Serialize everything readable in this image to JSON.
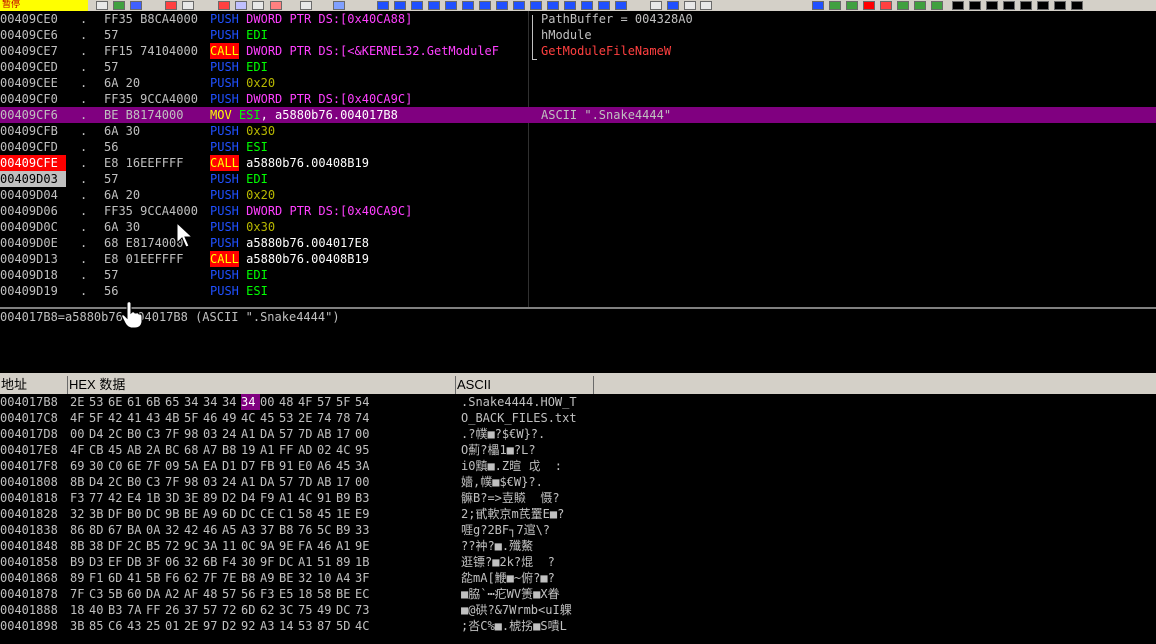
{
  "toolbar": {
    "status": "暂停",
    "colors": {
      "bar": "#d4d0c8",
      "status_bg": "#ffff00",
      "status_text": "#c00000"
    }
  },
  "cpu": {
    "rows": [
      {
        "addr": "00409CE0",
        "mark": ".",
        "hex": "FF35 B8CA4000",
        "op": "PUSH",
        "mcls": "mn-push",
        "parts": [
          {
            "t": "DWORD PTR DS:[0x40CA88]",
            "c": "op-mem"
          }
        ],
        "comment": "PathBuffer = 004328A0",
        "ccls": "",
        "addrcls": "",
        "sel": false
      },
      {
        "addr": "00409CE6",
        "mark": ".",
        "hex": "57",
        "op": "PUSH",
        "mcls": "mn-push",
        "parts": [
          {
            "t": "EDI",
            "c": "op-reg"
          }
        ],
        "comment": "hModule",
        "ccls": "",
        "addrcls": "",
        "sel": false
      },
      {
        "addr": "00409CE7",
        "mark": ".",
        "hex": "FF15 74104000",
        "op": "CALL",
        "mcls": "mn-call",
        "parts": [
          {
            "t": "DWORD PTR DS:[<&KERNEL32.GetModuleF",
            "c": "op-mem"
          }
        ],
        "comment": "GetModuleFileNameW",
        "ccls": "api",
        "addrcls": "",
        "sel": false
      },
      {
        "addr": "00409CED",
        "mark": ".",
        "hex": "57",
        "op": "PUSH",
        "mcls": "mn-push",
        "parts": [
          {
            "t": "EDI",
            "c": "op-reg"
          }
        ],
        "comment": "",
        "ccls": "",
        "addrcls": "",
        "sel": false
      },
      {
        "addr": "00409CEE",
        "mark": ".",
        "hex": "6A 20",
        "op": "PUSH",
        "mcls": "mn-push",
        "parts": [
          {
            "t": "0x20",
            "c": "op-imm"
          }
        ],
        "comment": "",
        "ccls": "",
        "addrcls": "",
        "sel": false
      },
      {
        "addr": "00409CF0",
        "mark": ".",
        "hex": "FF35 9CCA4000",
        "op": "PUSH",
        "mcls": "mn-push",
        "parts": [
          {
            "t": "DWORD PTR DS:[0x40CA9C]",
            "c": "op-mem"
          }
        ],
        "comment": "",
        "ccls": "",
        "addrcls": "",
        "sel": false
      },
      {
        "addr": "00409CF6",
        "mark": ".",
        "hex": "BE B8174000",
        "op": "MOV",
        "mcls": "mn-mov",
        "parts": [
          {
            "t": "ESI",
            "c": "op-reg"
          },
          {
            "t": ", a5880b76.004017B8",
            "c": "op-addr"
          }
        ],
        "comment": "ASCII \".Snake4444\"",
        "ccls": "",
        "addrcls": "",
        "sel": true
      },
      {
        "addr": "00409CFB",
        "mark": ".",
        "hex": "6A 30",
        "op": "PUSH",
        "mcls": "mn-push",
        "parts": [
          {
            "t": "0x30",
            "c": "op-imm"
          }
        ],
        "comment": "",
        "ccls": "",
        "addrcls": "",
        "sel": false
      },
      {
        "addr": "00409CFD",
        "mark": ".",
        "hex": "56",
        "op": "PUSH",
        "mcls": "mn-push",
        "parts": [
          {
            "t": "ESI",
            "c": "op-reg"
          }
        ],
        "comment": "",
        "ccls": "",
        "addrcls": "",
        "sel": false
      },
      {
        "addr": "00409CFE",
        "mark": ".",
        "hex": "E8 16EEFFFF",
        "op": "CALL",
        "mcls": "mn-call",
        "parts": [
          {
            "t": "a5880b76.00408B19",
            "c": "op-addr"
          }
        ],
        "comment": "",
        "ccls": "",
        "addrcls": "bp",
        "sel": false
      },
      {
        "addr": "00409D03",
        "mark": ".",
        "hex": "57",
        "op": "PUSH",
        "mcls": "mn-push",
        "parts": [
          {
            "t": "EDI",
            "c": "op-reg"
          }
        ],
        "comment": "",
        "ccls": "",
        "addrcls": "eip",
        "sel": false
      },
      {
        "addr": "00409D04",
        "mark": ".",
        "hex": "6A 20",
        "op": "PUSH",
        "mcls": "mn-push",
        "parts": [
          {
            "t": "0x20",
            "c": "op-imm"
          }
        ],
        "comment": "",
        "ccls": "",
        "addrcls": "",
        "sel": false
      },
      {
        "addr": "00409D06",
        "mark": ".",
        "hex": "FF35 9CCA4000",
        "op": "PUSH",
        "mcls": "mn-push",
        "parts": [
          {
            "t": "DWORD PTR DS:[0x40CA9C]",
            "c": "op-mem"
          }
        ],
        "comment": "",
        "ccls": "",
        "addrcls": "",
        "sel": false
      },
      {
        "addr": "00409D0C",
        "mark": ".",
        "hex": "6A 30",
        "op": "PUSH",
        "mcls": "mn-push",
        "parts": [
          {
            "t": "0x30",
            "c": "op-imm"
          }
        ],
        "comment": "",
        "ccls": "",
        "addrcls": "",
        "sel": false
      },
      {
        "addr": "00409D0E",
        "mark": ".",
        "hex": "68 E8174000",
        "op": "PUSH",
        "mcls": "mn-push",
        "parts": [
          {
            "t": "a5880b76.004017E8",
            "c": "op-addr"
          }
        ],
        "comment": "",
        "ccls": "",
        "addrcls": "",
        "sel": false
      },
      {
        "addr": "00409D13",
        "mark": ".",
        "hex": "E8 01EEFFFF",
        "op": "CALL",
        "mcls": "mn-call",
        "parts": [
          {
            "t": "a5880b76.00408B19",
            "c": "op-addr"
          }
        ],
        "comment": "",
        "ccls": "",
        "addrcls": "",
        "sel": false
      },
      {
        "addr": "00409D18",
        "mark": ".",
        "hex": "57",
        "op": "PUSH",
        "mcls": "mn-push",
        "parts": [
          {
            "t": "EDI",
            "c": "op-reg"
          }
        ],
        "comment": "",
        "ccls": "",
        "addrcls": "",
        "sel": false
      },
      {
        "addr": "00409D19",
        "mark": ".",
        "hex": "56",
        "op": "PUSH",
        "mcls": "mn-push",
        "parts": [
          {
            "t": "ESI",
            "c": "op-reg"
          }
        ],
        "comment": "",
        "ccls": "",
        "addrcls": "",
        "sel": false
      }
    ],
    "colors": {
      "selected_row": "#800080",
      "breakpoint": "#ff0000",
      "push": "#2050ff",
      "call_bg": "#ff0000",
      "call_fg": "#ffff00",
      "memory": "#ff40ff",
      "register": "#00ff00"
    }
  },
  "info": {
    "line": "004017B8=a5880b76.004017B8 (ASCII \".Snake4444\")"
  },
  "dump": {
    "headers": {
      "address": "地址",
      "hex": "HEX 数据",
      "ascii": "ASCII"
    },
    "rows": [
      {
        "addr": "004017B8",
        "bytes": [
          "2E",
          "53",
          "6E",
          "61",
          "6B",
          "65",
          "34",
          "34",
          "34",
          "34",
          "00",
          "48",
          "4F",
          "57",
          "5F",
          "54"
        ],
        "ascii": ".Snake4444.HOW_T",
        "hl": 9
      },
      {
        "addr": "004017C8",
        "bytes": [
          "4F",
          "5F",
          "42",
          "41",
          "43",
          "4B",
          "5F",
          "46",
          "49",
          "4C",
          "45",
          "53",
          "2E",
          "74",
          "78",
          "74"
        ],
        "ascii": "O_BACK_FILES.txt",
        "hl": -1
      },
      {
        "addr": "004017D8",
        "bytes": [
          "00",
          "D4",
          "2C",
          "B0",
          "C3",
          "7F",
          "98",
          "03",
          "24",
          "A1",
          "DA",
          "57",
          "7D",
          "AB",
          "17",
          "00"
        ],
        "ascii": ".?幞■?$€W}?.",
        "hl": -1
      },
      {
        "addr": "004017E8",
        "bytes": [
          "4F",
          "CB",
          "45",
          "AB",
          "2A",
          "BC",
          "68",
          "A7",
          "B8",
          "19",
          "A1",
          "FF",
          "AD",
          "02",
          "4C",
          "95"
        ],
        "ascii": "O薊?櫑1■?L?",
        "hl": -1
      },
      {
        "addr": "004017F8",
        "bytes": [
          "69",
          "30",
          "C0",
          "6E",
          "7F",
          "09",
          "5A",
          "EA",
          "D1",
          "D7",
          "FB",
          "91",
          "E0",
          "A6",
          "45",
          "3A"
        ],
        "ascii": "i0黰■.Z暄 戉  :",
        "hl": -1
      },
      {
        "addr": "00401808",
        "bytes": [
          "8B",
          "D4",
          "2C",
          "B0",
          "C3",
          "7F",
          "98",
          "03",
          "24",
          "A1",
          "DA",
          "57",
          "7D",
          "AB",
          "17",
          "00"
        ],
        "ascii": "嬙,幞■$€W}?.",
        "hl": -1
      },
      {
        "addr": "00401818",
        "bytes": [
          "F3",
          "77",
          "42",
          "E4",
          "1B",
          "3D",
          "3E",
          "89",
          "D2",
          "D4",
          "F9",
          "A1",
          "4C",
          "91",
          "B9",
          "B3"
        ],
        "ascii": "髍B?=>壴贆  慑?",
        "hl": -1
      },
      {
        "addr": "00401828",
        "bytes": [
          "32",
          "3B",
          "DF",
          "B0",
          "DC",
          "9B",
          "BE",
          "A9",
          "6D",
          "DC",
          "CE",
          "C1",
          "58",
          "45",
          "1E",
          "E9"
        ],
        "ascii": "2;甙軟京m芪罿E■?",
        "hl": -1
      },
      {
        "addr": "00401838",
        "bytes": [
          "86",
          "8D",
          "67",
          "BA",
          "0A",
          "32",
          "42",
          "46",
          "A5",
          "A3",
          "37",
          "B8",
          "76",
          "5C",
          "B9",
          "33"
        ],
        "ascii": "啀g?2BF┐7逭\\?",
        "hl": -1
      },
      {
        "addr": "00401848",
        "bytes": [
          "8B",
          "38",
          "DF",
          "2C",
          "B5",
          "72",
          "9C",
          "3A",
          "11",
          "0C",
          "9A",
          "9E",
          "FA",
          "46",
          "A1",
          "9E"
        ],
        "ascii": "??衶?■.殲鰲",
        "hl": -1
      },
      {
        "addr": "00401858",
        "bytes": [
          "B9",
          "D3",
          "EF",
          "DB",
          "3F",
          "06",
          "32",
          "6B",
          "F4",
          "30",
          "9F",
          "DC",
          "A1",
          "51",
          "89",
          "1B"
        ],
        "ascii": "逛镖?■2k?焜  ?",
        "hl": -1
      },
      {
        "addr": "00401868",
        "bytes": [
          "89",
          "F1",
          "6D",
          "41",
          "5B",
          "F6",
          "62",
          "7F",
          "7E",
          "B8",
          "A9",
          "BE",
          "32",
          "10",
          "A4",
          "3F"
        ],
        "ascii": "夞mA[鯾■~俯?■?",
        "hl": -1
      },
      {
        "addr": "00401878",
        "bytes": [
          "7F",
          "C3",
          "5B",
          "60",
          "DA",
          "A2",
          "AF",
          "48",
          "57",
          "56",
          "F3",
          "E5",
          "18",
          "58",
          "BE",
          "EC"
        ],
        "ascii": "■脇`┅疕WV箦■X眷",
        "hl": -1
      },
      {
        "addr": "00401888",
        "bytes": [
          "18",
          "40",
          "B3",
          "7A",
          "FF",
          "26",
          "37",
          "57",
          "72",
          "6D",
          "62",
          "3C",
          "75",
          "49",
          "DC",
          "73"
        ],
        "ascii": "■@硔?&7Wrmb<uI躶",
        "hl": -1
      },
      {
        "addr": "00401898",
        "bytes": [
          "3B",
          "85",
          "C6",
          "43",
          "25",
          "01",
          "2E",
          "97",
          "D2",
          "92",
          "A3",
          "14",
          "53",
          "87",
          "5D",
          "4C"
        ],
        "ascii": ";呇C%■.椃挘■S嘳L",
        "hl": -1
      }
    ],
    "colors": {
      "highlight": "#800080",
      "header_bg": "#d4d0c8"
    }
  }
}
